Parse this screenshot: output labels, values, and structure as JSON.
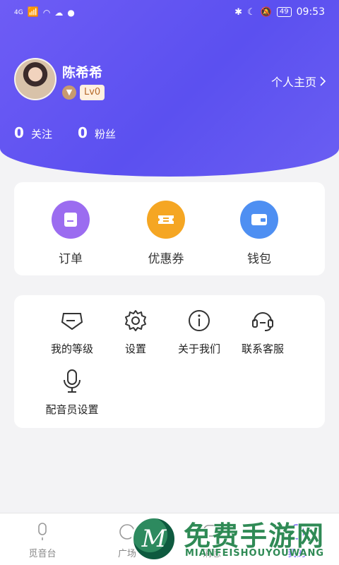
{
  "status_bar": {
    "network": "4G",
    "battery": "49",
    "time": "09:53"
  },
  "profile": {
    "name": "陈希希",
    "level": "Lv0",
    "homepage_link": "个人主页",
    "following_count": "0",
    "following_label": "关注",
    "followers_count": "0",
    "followers_label": "粉丝"
  },
  "quick_actions": [
    {
      "label": "订单",
      "icon": "order-icon",
      "color": "#9b6cf0"
    },
    {
      "label": "优惠券",
      "icon": "coupon-icon",
      "color": "#f5a623"
    },
    {
      "label": "钱包",
      "icon": "wallet-icon",
      "color": "#4e8ff2"
    }
  ],
  "menu": [
    {
      "label": "我的等级",
      "icon": "level-icon"
    },
    {
      "label": "设置",
      "icon": "gear-icon"
    },
    {
      "label": "关于我们",
      "icon": "info-icon"
    },
    {
      "label": "联系客服",
      "icon": "headset-icon"
    },
    {
      "label": "配音员设置",
      "icon": "microphone-icon"
    }
  ],
  "tabs": [
    {
      "label": "觅音台",
      "icon": "microphone-tab-icon"
    },
    {
      "label": "广场",
      "icon": "plaza-icon"
    },
    {
      "label": "消息",
      "icon": "message-icon"
    },
    {
      "label": "我的",
      "icon": "profile-icon"
    }
  ],
  "watermark": {
    "title": "免费手游网",
    "subtitle": "MIANFEISHOUYOUWANG",
    "logo_letter": "M"
  }
}
